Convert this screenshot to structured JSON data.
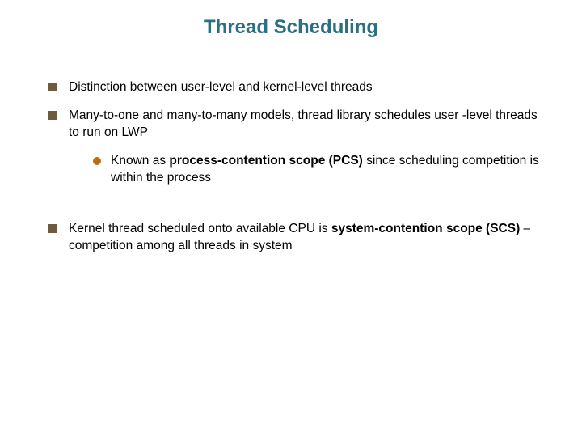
{
  "title": "Thread Scheduling",
  "bullets": {
    "item1": "Distinction between user-level and kernel-level threads",
    "item2": "Many-to-one and many-to-many models, thread library schedules user -level threads to run on LWP",
    "sub1_prefix": "Known as ",
    "sub1_bold": "process-contention scope (PCS)",
    "sub1_suffix": " since scheduling competition is within the process",
    "item3_prefix": "Kernel thread scheduled onto available CPU is ",
    "item3_bold": "system-contention scope (SCS)",
    "item3_suffix": " – competition among all threads in system"
  }
}
